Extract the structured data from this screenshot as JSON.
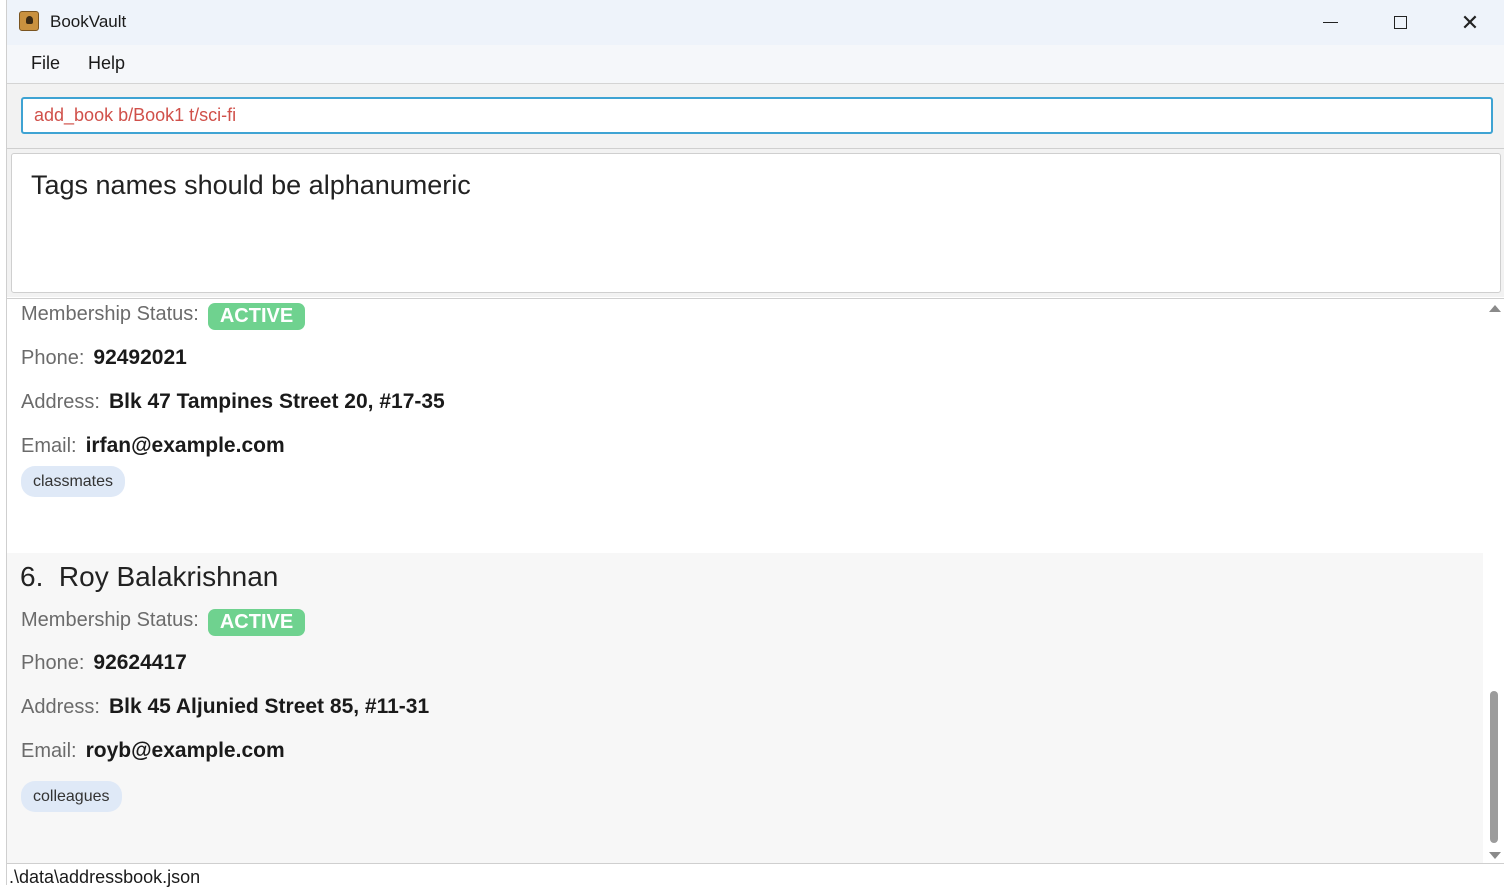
{
  "window": {
    "title": "BookVault",
    "minimize_icon": "minimize-icon",
    "maximize_icon": "maximize-icon",
    "close_glyph": "✕"
  },
  "menu": {
    "items": [
      {
        "label": "File"
      },
      {
        "label": "Help"
      }
    ]
  },
  "command": {
    "value": "add_book b/Book1 t/sci-fi"
  },
  "result": {
    "message": "Tags names should be alphanumeric"
  },
  "labels": {
    "status": "Membership Status:",
    "phone": "Phone:",
    "address": "Address:",
    "email": "Email:"
  },
  "members": [
    {
      "index": "",
      "name": "",
      "status": "ACTIVE",
      "phone": "92492021",
      "address": "Blk 47 Tampines Street 20, #17-35",
      "email": "irfan@example.com",
      "tags": [
        "classmates"
      ]
    },
    {
      "index": "6.",
      "name": "Roy Balakrishnan",
      "status": "ACTIVE",
      "phone": "92624417",
      "address": "Blk 45 Aljunied Street 85, #11-31",
      "email": "royb@example.com",
      "tags": [
        "colleagues"
      ]
    }
  ],
  "statusbar": {
    "path": ".\\data\\addressbook.json"
  },
  "colors": {
    "accent": "#3ea3d3",
    "error_text": "#d0504a",
    "badge_active": "#6fd28f",
    "tag_bg": "#dfe9f7"
  }
}
